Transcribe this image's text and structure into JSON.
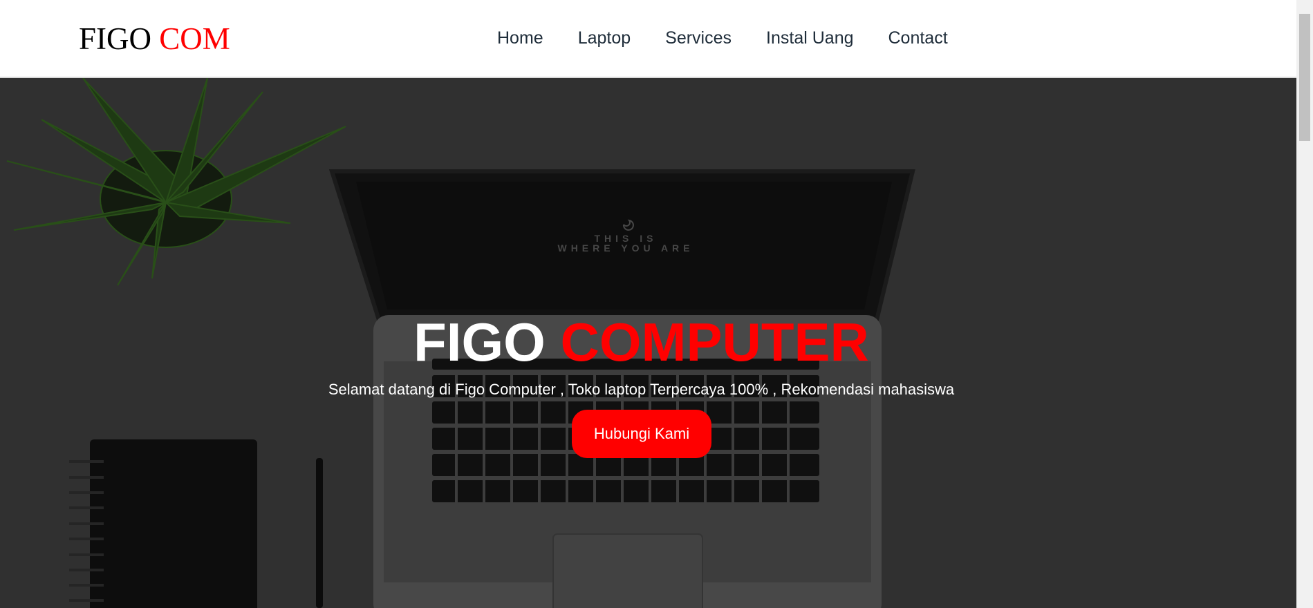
{
  "brand": {
    "part1": "FIGO",
    "part2": "COM"
  },
  "nav": [
    {
      "label": "Home"
    },
    {
      "label": "Laptop"
    },
    {
      "label": "Services"
    },
    {
      "label": "Instal Uang"
    },
    {
      "label": "Contact"
    }
  ],
  "hero": {
    "title_part1": "FIGO",
    "title_part2": "COMPUTER",
    "subtitle": "Selamat datang di Figo Computer , Toko laptop Terpercaya 100% , Rekomendasi mahasiswa",
    "cta": "Hubungi Kami",
    "screen_text_line1": "THIS IS",
    "screen_text_line2": "WHERE YOU ARE"
  },
  "colors": {
    "accent": "#ff0000",
    "nav_text": "#1f2d3a",
    "background": "#3b3b3b"
  }
}
